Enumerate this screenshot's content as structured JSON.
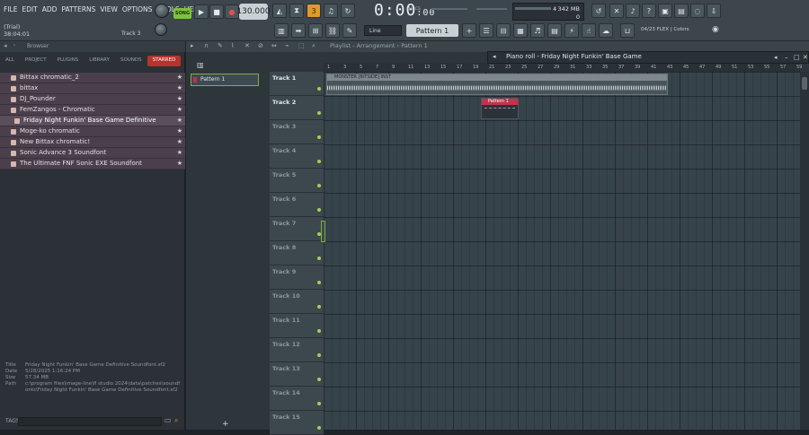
{
  "menu": [
    "FILE",
    "EDIT",
    "ADD",
    "PATTERNS",
    "VIEW",
    "OPTIONS",
    "TOOLS",
    "HELP"
  ],
  "info": {
    "trial": "(Trial)",
    "time_small": "38:04:01",
    "track_hint": "Track 3"
  },
  "transport": {
    "song_label": "SONG",
    "tempo": "130.000",
    "time": "0:00",
    "time_frac": ":00",
    "mbs": "M:S:CS"
  },
  "cpu": {
    "voices": "4",
    "memory": "342 MB",
    "poly": "0"
  },
  "toolbar": {
    "snap": "Line",
    "pattern": "Pattern 1",
    "flex": "04/23 FLEX | Colors"
  },
  "browser": {
    "title": "Browser",
    "tabs": [
      "ALL",
      "PROJECT",
      "PLUGINS",
      "LIBRARY",
      "SOUNDS",
      "STARRED"
    ],
    "active_tab": "STARRED",
    "items": [
      "Bittax chromatic_2",
      "bittax",
      "DJ_Pounder",
      "FemZangos - Chromatic",
      "Friday Night Funkin' Base Game Definitive Soundfont",
      "Moge-ko chromatic",
      "New Bittax chromatic!",
      "Sonic Advance 3 Soundfont",
      "The Ultimate FNF Sonic EXE Soundfont"
    ],
    "info": {
      "title_k": "Title",
      "title_v": "Friday Night Funkin' Base Game Definitive Soundfont.sf2",
      "date_k": "Date",
      "date_v": "5/28/2025 1:16:24 PM",
      "size_k": "Size",
      "size_v": "57.34 MB",
      "path_k": "Path",
      "path_v": "c:\\program files\\image-line\\fl studio 2024\\data\\patches\\soundfonts\\Friday Night Funkin' Base Game Definitive Soundfont.sf2"
    },
    "tags": "TAGS"
  },
  "playlist": {
    "title": "Playlist - Arrangement › Pattern 1",
    "picker": "Pattern 1",
    "tracks": [
      "Track 1",
      "Track 2",
      "Track 3",
      "Track 4",
      "Track 5",
      "Track 6",
      "Track 7",
      "Track 8",
      "Track 9",
      "Track 10",
      "Track 11",
      "Track 12",
      "Track 13",
      "Track 14",
      "Track 15"
    ],
    "ruler": [
      "1",
      "3",
      "5",
      "7",
      "9",
      "11",
      "13",
      "15",
      "17",
      "19",
      "21",
      "23",
      "25",
      "27",
      "29",
      "31",
      "33",
      "35",
      "37",
      "39",
      "41",
      "43",
      "45",
      "47",
      "49",
      "51",
      "53",
      "55",
      "57",
      "59"
    ],
    "clip_audio": "MONSTER [BITSIDE] INST",
    "clip_pattern": "Pattern 1"
  },
  "pianoroll": {
    "title": "Piano roll - Friday Night Funkin' Base Game"
  }
}
